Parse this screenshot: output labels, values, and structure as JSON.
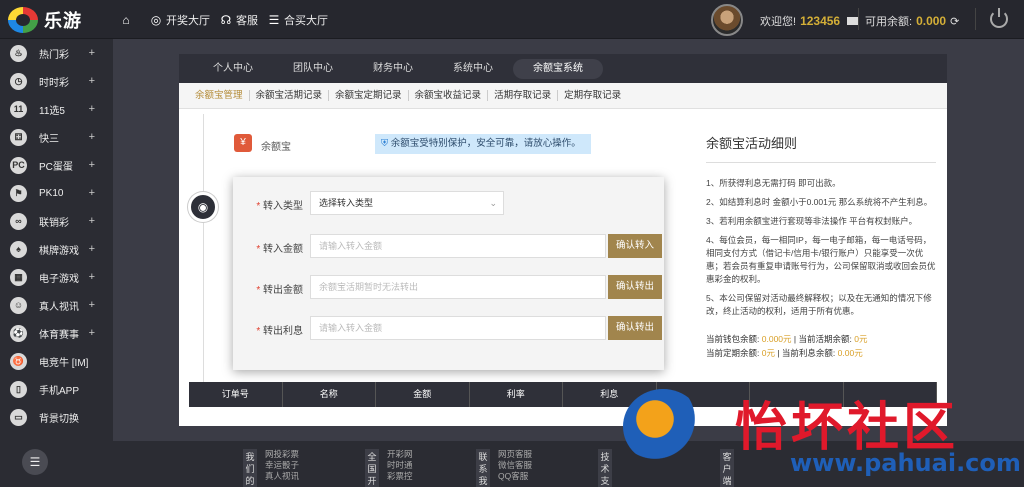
{
  "logo": {
    "text": "乐游"
  },
  "topnav": {
    "home_icon": "home-icon",
    "draw_hall": "开奖大厅",
    "service": "客服",
    "buy_hall": "合买大厅"
  },
  "user": {
    "welcome": "欢迎您!",
    "name": "123456",
    "balance_label": "可用余额:",
    "balance": "0.000"
  },
  "sidebar": {
    "items": [
      {
        "label": "热门彩",
        "icon": "fire-icon",
        "plus": "+"
      },
      {
        "label": "时时彩",
        "icon": "clock-icon",
        "plus": "+"
      },
      {
        "label": "11选5",
        "icon": "eleven-five-icon",
        "plus": "+"
      },
      {
        "label": "快三",
        "icon": "dice-icon",
        "plus": "+"
      },
      {
        "label": "PC蛋蛋",
        "icon": "pc-egg-icon",
        "plus": "+"
      },
      {
        "label": "PK10",
        "icon": "racing-icon",
        "plus": "+"
      },
      {
        "label": "联销彩",
        "icon": "link-icon",
        "plus": "+"
      },
      {
        "label": "棋牌游戏",
        "icon": "cards-icon",
        "plus": "+"
      },
      {
        "label": "电子游戏",
        "icon": "slot-icon",
        "plus": "+"
      },
      {
        "label": "真人视讯",
        "icon": "person-icon",
        "plus": "+"
      },
      {
        "label": "体育赛事",
        "icon": "soccer-icon",
        "plus": "+"
      },
      {
        "label": "电竞牛 [IM]",
        "icon": "bull-icon",
        "plus": ""
      },
      {
        "label": "手机APP",
        "icon": "phone-icon",
        "plus": ""
      },
      {
        "label": "背景切换",
        "icon": "monitor-icon",
        "plus": ""
      }
    ]
  },
  "tabs": [
    "个人中心",
    "团队中心",
    "财务中心",
    "系统中心",
    "余额宝系统"
  ],
  "subtabs": [
    "余额宝管理",
    "余额宝活期记录",
    "余额宝定期记录",
    "余额宝收益记录",
    "活期存取记录",
    "定期存取记录"
  ],
  "yeb": {
    "title": "余额宝",
    "notice": "余额宝受特别保护，安全可靠，请放心操作。"
  },
  "form": {
    "rows": [
      {
        "label": "转入类型",
        "value": "选择转入类型",
        "button": ""
      },
      {
        "label": "转入金额",
        "value": "请输入转入金额",
        "button": "确认转入"
      },
      {
        "label": "转出金额",
        "value": "余额宝活期暂时无法转出",
        "button": "确认转出"
      },
      {
        "label": "转出利息",
        "value": "请输入转入金额",
        "button": "确认转出"
      }
    ]
  },
  "notes": {
    "title": "余额宝活动细则",
    "items": [
      "1、所获得利息无需打码 即可出款。",
      "2、如结算利息时 金额小于0.001元 那么系统将不产生利息。",
      "3、若利用余额宝进行套现等非法操作 平台有权封账户。",
      "4、每位会员，每一相同IP，每一电子邮箱，每一电话号码，相同支付方式（借记卡/信用卡/银行账户）只能享受一次优惠；若会员有重复申请账号行为，公司保留取消或收回会员优惠彩金的权利。",
      "5、本公司保留对活动最终解释权；以及在无通知的情况下修改，终止活动的权利，适用于所有优惠。"
    ],
    "bal_line1_a": "当前钱包余额:",
    "bal_line1_b": "0.000元",
    "bal_line1_c": "| 当前活期余额:",
    "bal_line1_d": "0元",
    "bal_line2_a": "当前定期余额:",
    "bal_line2_b": "0元",
    "bal_line2_c": "| 当前利息余额:",
    "bal_line2_d": "0.00元"
  },
  "table": {
    "headers": [
      "订单号",
      "名称",
      "金额",
      "利率",
      "利息",
      "",
      "",
      ""
    ]
  },
  "footer": [
    {
      "head": "我们的",
      "links": [
        "网投彩票",
        "幸运骰子",
        "真人视讯"
      ]
    },
    {
      "head": "全国开",
      "links": [
        "开彩网",
        "时时通",
        "彩票控"
      ]
    },
    {
      "head": "联系我",
      "links": [
        "网页客服",
        "微信客服",
        "QQ客服"
      ]
    },
    {
      "head": "技术支",
      "links": [
        ""
      ]
    },
    {
      "head": "客户端",
      "links": [
        ""
      ]
    }
  ],
  "watermark": {
    "text": "怡坏社区",
    "url": "www.pahuai.com"
  }
}
